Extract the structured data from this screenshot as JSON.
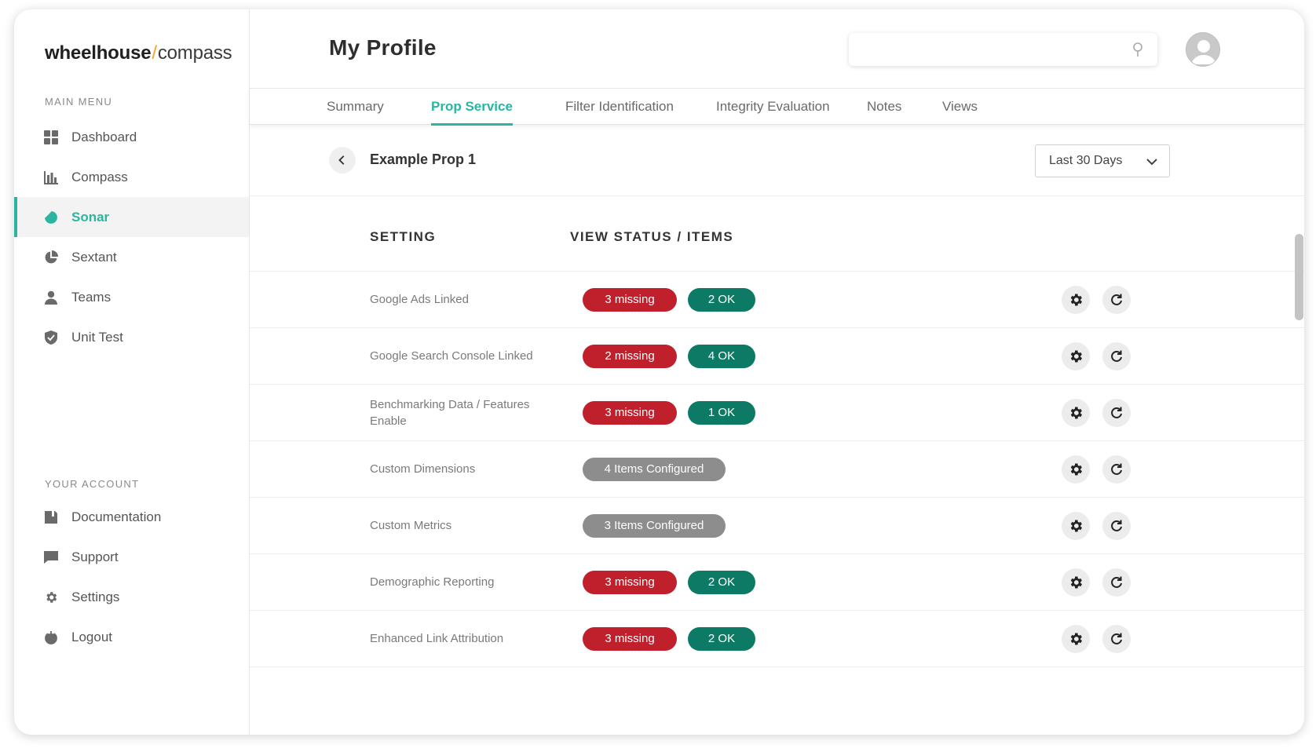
{
  "brand": {
    "bold": "wheelhouse",
    "slash": "/",
    "light": "compass"
  },
  "sidebar": {
    "main_label": "MAIN MENU",
    "main_items": [
      {
        "label": "Dashboard",
        "icon": "dashboard-icon"
      },
      {
        "label": "Compass",
        "icon": "bar-chart-icon"
      },
      {
        "label": "Sonar",
        "icon": "sonar-icon",
        "active": true
      },
      {
        "label": "Sextant",
        "icon": "pie-chart-icon"
      },
      {
        "label": "Teams",
        "icon": "user-icon"
      },
      {
        "label": "Unit Test",
        "icon": "shield-icon"
      }
    ],
    "account_label": "YOUR ACCOUNT",
    "account_items": [
      {
        "label": "Documentation",
        "icon": "book-icon"
      },
      {
        "label": "Support",
        "icon": "chat-icon"
      },
      {
        "label": "Settings",
        "icon": "gear-icon"
      },
      {
        "label": "Logout",
        "icon": "power-icon"
      }
    ]
  },
  "header": {
    "title": "My Profile",
    "search_placeholder": "",
    "search_value": ""
  },
  "tabs": [
    {
      "label": "Summary"
    },
    {
      "label": "Prop Service",
      "active": true
    },
    {
      "label": "Filter Identification"
    },
    {
      "label": "Integrity Evaluation"
    },
    {
      "label": "Notes"
    },
    {
      "label": "Views"
    }
  ],
  "subheader": {
    "prop_name": "Example Prop 1",
    "range": "Last 30 Days"
  },
  "table": {
    "col_setting": "SETTING",
    "col_status": "VIEW STATUS / ITEMS",
    "rows": [
      {
        "setting": "Google Ads Linked",
        "missing": "3 missing",
        "ok": "2 OK"
      },
      {
        "setting": "Google Search Console Linked",
        "missing": "2 missing",
        "ok": "4 OK"
      },
      {
        "setting": "Benchmarking Data / Features Enable",
        "missing": "3 missing",
        "ok": "1 OK"
      },
      {
        "setting": "Custom Dimensions",
        "configured": "4 Items Configured"
      },
      {
        "setting": "Custom Metrics",
        "configured": "3 Items Configured"
      },
      {
        "setting": "Demographic Reporting",
        "missing": "3 missing",
        "ok": "2 OK"
      },
      {
        "setting": "Enhanced Link Attribution",
        "missing": "3 missing",
        "ok": "2 OK"
      }
    ]
  },
  "colors": {
    "accent": "#2bb5a0",
    "missing": "#c0202b",
    "ok": "#0d7a66",
    "configured": "#8d8d8d"
  }
}
